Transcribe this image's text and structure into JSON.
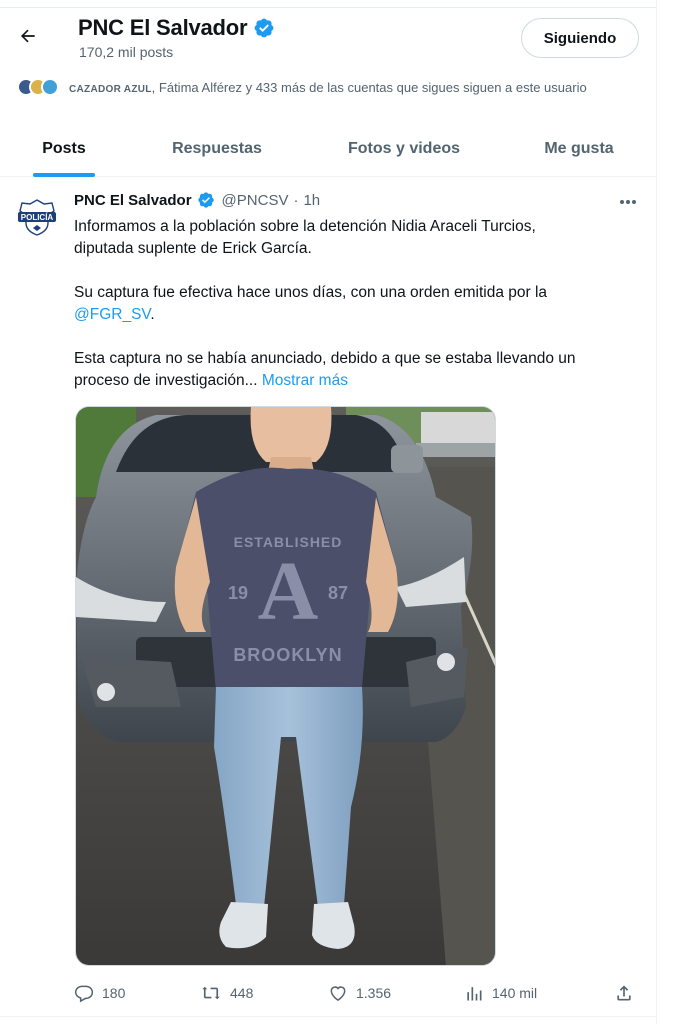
{
  "header": {
    "title": "PNC El Salvador",
    "posts_count": "170,2 mil posts",
    "follow_label": "Siguiendo"
  },
  "followers_known": {
    "first": "CAZADOR AZUL",
    "rest": ", Fátima Alférez y 433 más de las cuentas que sigues siguen a este usuario"
  },
  "tabs": [
    {
      "label": "Posts",
      "active": true
    },
    {
      "label": "Respuestas",
      "active": false
    },
    {
      "label": "Fotos y videos",
      "active": false
    },
    {
      "label": "Me gusta",
      "active": false
    }
  ],
  "post": {
    "author": "PNC El Salvador",
    "handle": "@PNCSV",
    "separator": "·",
    "time": "1h",
    "avatar_text": "POLICÍA",
    "text_line1": "Informamos a la población sobre la detención Nidia Araceli Turcios,",
    "text_line2": "diputada suplente de Erick García.",
    "text_line3": "Su captura fue efectiva hace unos días, con una orden emitida por la",
    "mention": "@FGR_SV",
    "text_line4_end": ".",
    "text_line5": "Esta captura no se había anunciado, debido a que se estaba llevando un",
    "text_line6": "proceso de investigación...",
    "show_more": "Mostrar más",
    "shirt_top": "ESTABLISHED",
    "shirt_year_left": "19",
    "shirt_letter": "A",
    "shirt_year_right": "87",
    "shirt_bottom": "BROOKLYN",
    "stats": {
      "replies": "180",
      "reposts": "448",
      "likes": "1.356",
      "views": "140 mil"
    }
  },
  "colors": {
    "accent": "#1d9bf0",
    "text": "#0f1419",
    "secondary": "#536471"
  }
}
